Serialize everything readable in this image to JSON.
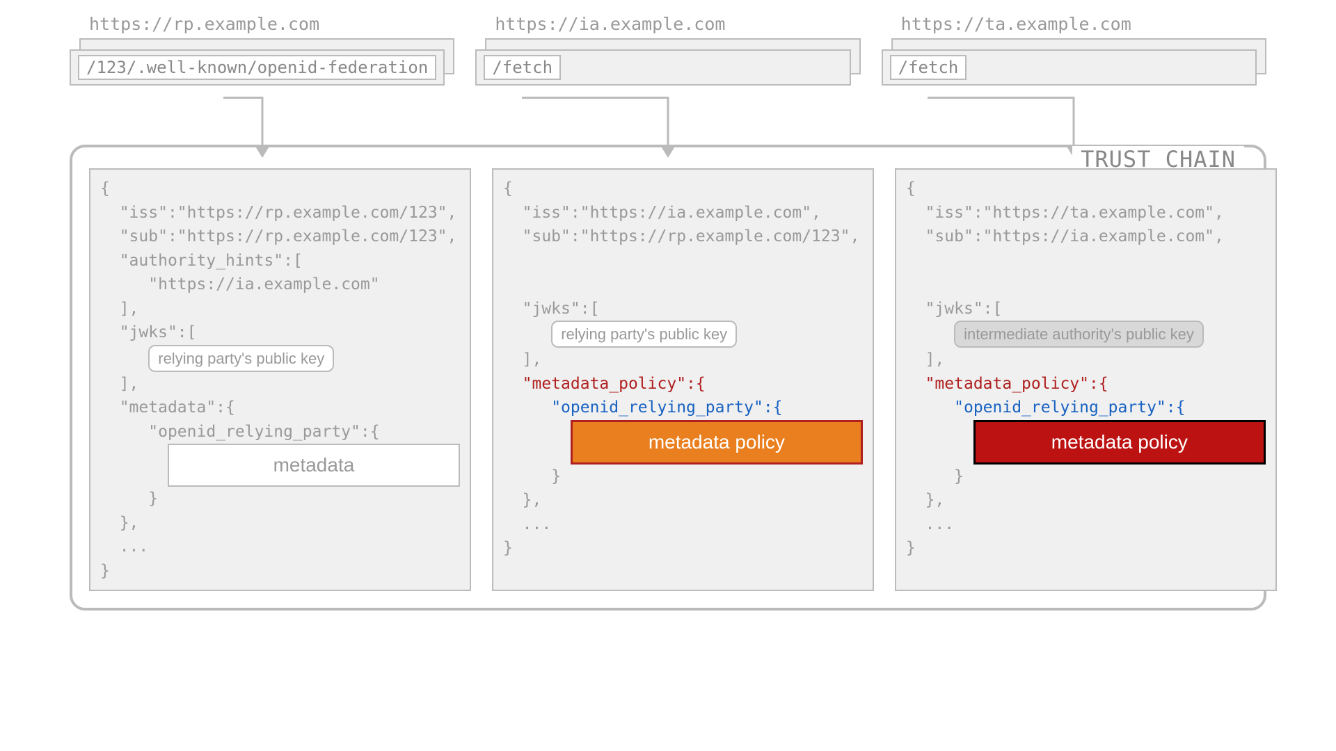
{
  "urls": {
    "rp": "https://rp.example.com",
    "ia": "https://ia.example.com",
    "ta": "https://ta.example.com"
  },
  "paths": {
    "rp": "/123/.well-known/openid-federation",
    "ia": "/fetch",
    "ta": "/fetch"
  },
  "chain_label": "TRUST CHAIN",
  "boxes": {
    "rp": {
      "iss": "\"iss\":\"https://rp.example.com/123\",",
      "sub": "\"sub\":\"https://rp.example.com/123\",",
      "auth_hints_open": "\"authority_hints\":[",
      "auth_hint_url": "\"https://ia.example.com\"",
      "jwks_open": "\"jwks\":[",
      "pubkey": "relying party's public key",
      "meta_open": "\"metadata\":{",
      "openid": "\"openid_relying_party\":{",
      "meta_label": "metadata"
    },
    "ia": {
      "iss": "\"iss\":\"https://ia.example.com\",",
      "sub": "\"sub\":\"https://rp.example.com/123\",",
      "jwks_open": "\"jwks\":[",
      "pubkey": "relying party's public key",
      "policy_open": "\"metadata_policy\":{",
      "openid": "\"openid_relying_party\":{",
      "policy_label": "metadata policy"
    },
    "ta": {
      "iss": "\"iss\":\"https://ta.example.com\",",
      "sub": "\"sub\":\"https://ia.example.com\",",
      "jwks_open": "\"jwks\":[",
      "pubkey": "intermediate authority's public key",
      "policy_open": "\"metadata_policy\":{",
      "openid": "\"openid_relying_party\":{",
      "policy_label": "metadata policy"
    }
  },
  "syntax": {
    "open_brace": "{",
    "close_brace": "}",
    "close_bracket": "],",
    "close_bracket_plain": "],",
    "close_curly_comma": "},",
    "close_curly": "}",
    "ellipsis": "..."
  }
}
